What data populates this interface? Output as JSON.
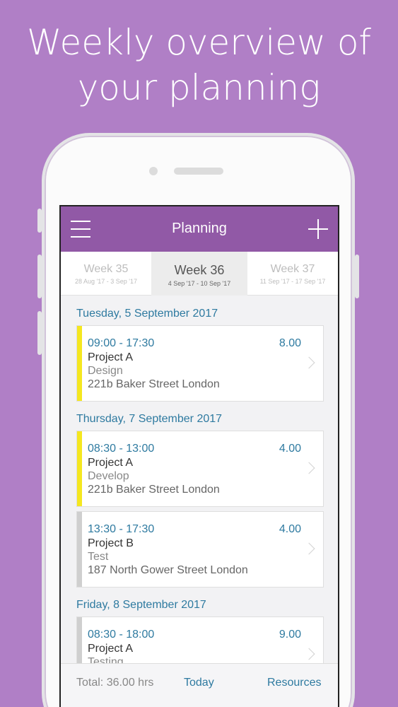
{
  "promo": {
    "line1": "Weekly overview of",
    "line2": "your planning"
  },
  "navbar": {
    "title": "Planning"
  },
  "weeks": [
    {
      "label": "Week 35",
      "range": "28 Aug '17 - 3 Sep '17"
    },
    {
      "label": "Week 36",
      "range": "4 Sep '17 - 10 Sep '17"
    },
    {
      "label": "Week 37",
      "range": "11 Sep '17 - 17 Sep '17"
    }
  ],
  "days": [
    {
      "header": "Tuesday, 5 September 2017"
    },
    {
      "header": "Thursday, 7 September 2017"
    },
    {
      "header": "Friday, 8 September 2017"
    }
  ],
  "entries": [
    {
      "time": "09:00 - 17:30",
      "hours": "8.00",
      "project": "Project A",
      "task": "Design",
      "address": "221b Baker Street London",
      "color": "#f5e71f"
    },
    {
      "time": "08:30 - 13:00",
      "hours": "4.00",
      "project": "Project A",
      "task": "Develop",
      "address": "221b Baker Street London",
      "color": "#f5e71f"
    },
    {
      "time": "13:30 - 17:30",
      "hours": "4.00",
      "project": "Project B",
      "task": "Test",
      "address": "187 North Gower Street London",
      "color": "#cfcfcf"
    },
    {
      "time": "08:30 - 18:00",
      "hours": "9.00",
      "project": "Project A",
      "task": "Testing",
      "address": "",
      "color": "#cfcfcf"
    }
  ],
  "footer": {
    "total": "Total: 36.00 hrs",
    "today": "Today",
    "resources": "Resources"
  },
  "colors": {
    "background": "#b07fc6",
    "navbar": "#9159a6",
    "accent": "#2e7aa0"
  },
  "icons": {
    "menu": "menu-icon",
    "add": "plus-icon",
    "chevron": "chevron-right-icon"
  }
}
